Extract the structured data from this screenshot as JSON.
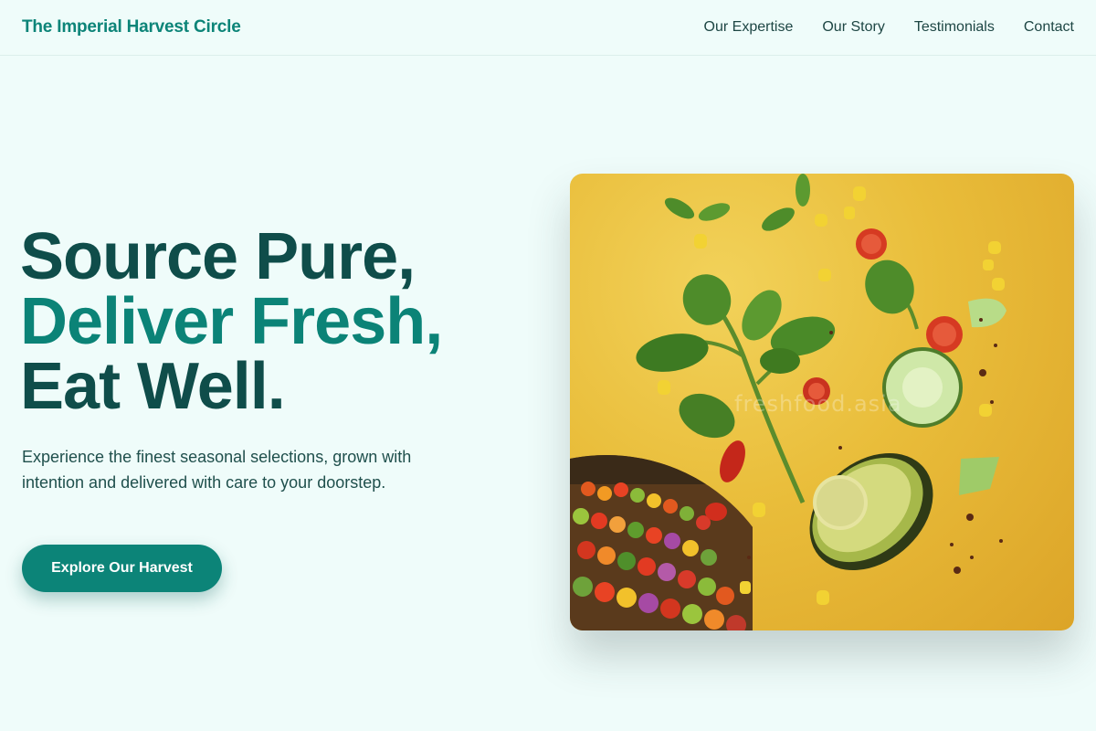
{
  "header": {
    "brand": "The Imperial Harvest Circle",
    "nav": [
      "Our Expertise",
      "Our Story",
      "Testimonials",
      "Contact"
    ]
  },
  "hero": {
    "title_line1": "Source Pure,",
    "title_line2": "Deliver Fresh,",
    "title_line3": "Eat Well.",
    "subtitle": "Experience the finest seasonal selections, grown with intention and delivered with care to your doorstep.",
    "cta_label": "Explore Our Harvest",
    "image_watermark": "freshfood.asia"
  },
  "colors": {
    "background": "#effcfa",
    "brand_teal": "#0c8478",
    "heading_dark": "#0f4d4a",
    "image_yellow": "#e9bd3a"
  }
}
